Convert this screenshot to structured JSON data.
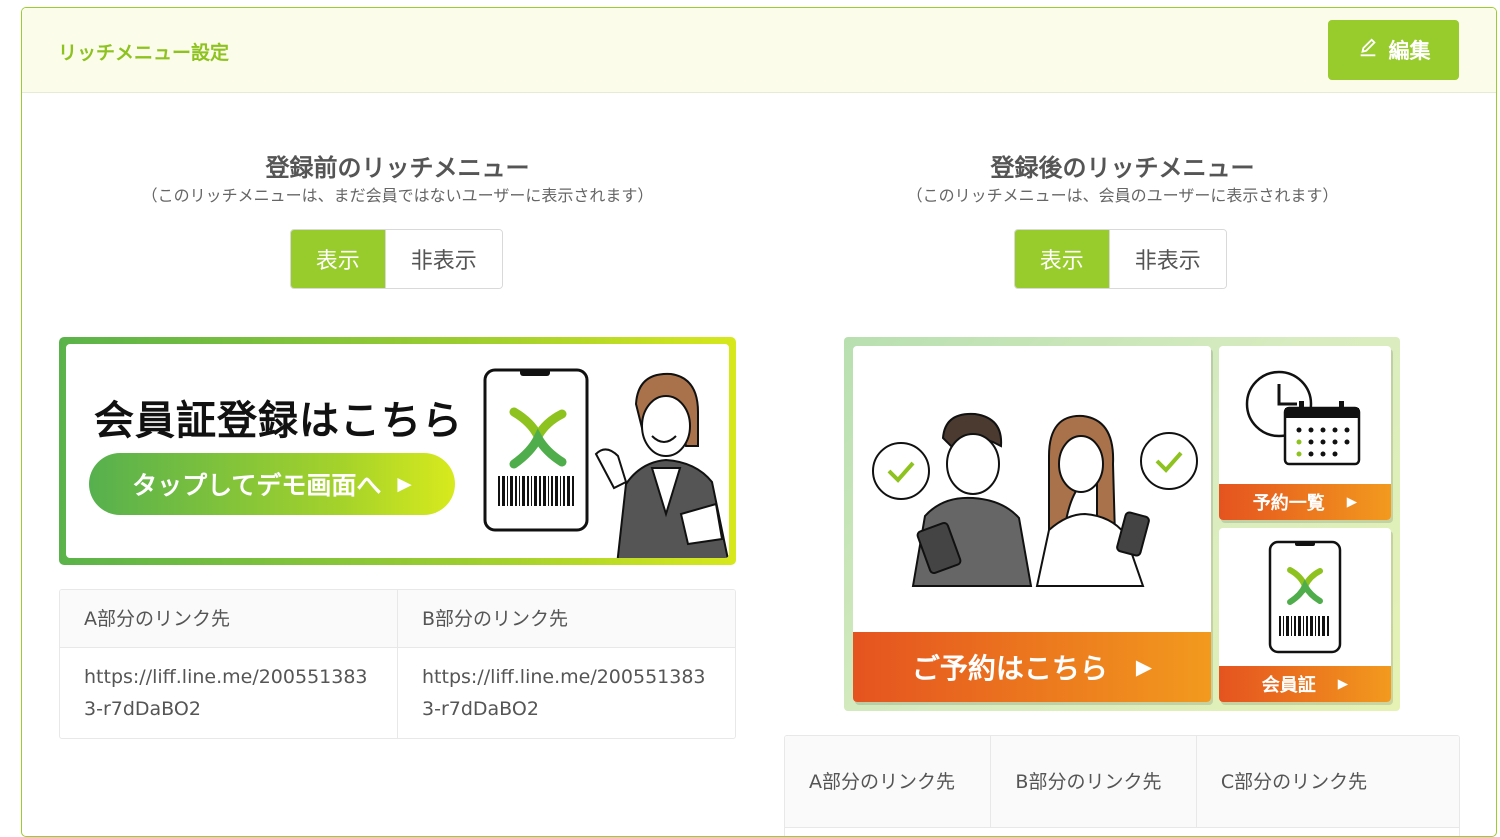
{
  "header": {
    "title": "リッチメニュー設定",
    "edit_label": "編集"
  },
  "before": {
    "title": "登録前のリッチメニュー",
    "subtitle": "（このリッチメニューは、まだ会員ではないユーザーに表示されます）",
    "toggle": {
      "show": "表示",
      "hide": "非表示",
      "selected": "表示"
    },
    "banner": {
      "headline": "会員証登録はこちら",
      "button": "タップしてデモ画面へ"
    },
    "links": {
      "headers": [
        "A部分のリンク先",
        "B部分のリンク先"
      ],
      "rows": [
        [
          "https://liff.line.me/2005513833-r7dDaBO2",
          "https://liff.line.me/2005513833-r7dDaBO2"
        ]
      ]
    }
  },
  "after": {
    "title": "登録後のリッチメニュー",
    "subtitle": "（このリッチメニューは、会員のユーザーに表示されます）",
    "toggle": {
      "show": "表示",
      "hide": "非表示",
      "selected": "表示"
    },
    "banner": {
      "main": "ご予約はこちら",
      "side_top": "予約一覧",
      "side_bottom": "会員証"
    },
    "links": {
      "headers": [
        "A部分のリンク先",
        "B部分のリンク先",
        "C部分のリンク先"
      ]
    }
  },
  "colors": {
    "accent": "#98cb2c",
    "title_green": "#8dc21f",
    "orange": "#ee7a1e",
    "header_bg": "#fbfdea"
  },
  "icons": [
    "pencil-icon",
    "play-triangle-icon",
    "check-bubble-icon",
    "clock-icon",
    "calendar-icon",
    "phone-card-icon",
    "barcode-icon"
  ]
}
